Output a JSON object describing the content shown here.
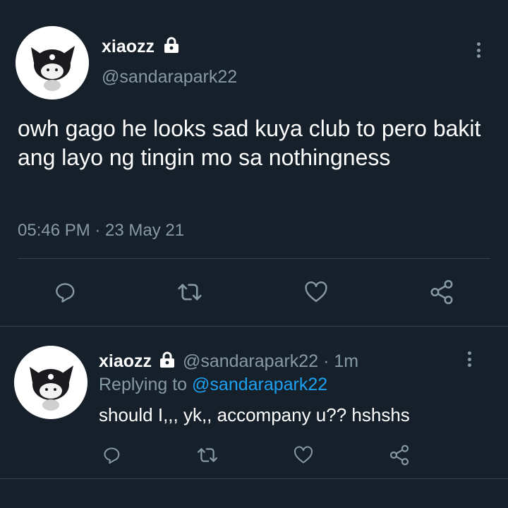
{
  "main_tweet": {
    "display_name": "xiaozz",
    "handle": "@sandarapark22",
    "text": "owh gago he looks sad kuya club to pero bakit ang layo ng tingin mo sa nothingness",
    "timestamp": "05:46 PM · 23 May 21",
    "actions": [
      "reply-icon",
      "retweet-icon",
      "like-icon",
      "share-icon"
    ]
  },
  "reply_tweet": {
    "display_name": "xiaozz",
    "handle": "@sandarapark22",
    "time_ago": "1m",
    "replying_prefix": "Replying to",
    "replying_to": "@sandarapark22",
    "text": "should I,,, yk,, accompany u?? hshshs",
    "actions": [
      "reply-icon",
      "retweet-icon",
      "like-icon",
      "share-icon"
    ]
  },
  "colors": {
    "background": "#15202b",
    "muted_text": "#8899a6",
    "link": "#1da1f2",
    "divider": "#38444d"
  }
}
